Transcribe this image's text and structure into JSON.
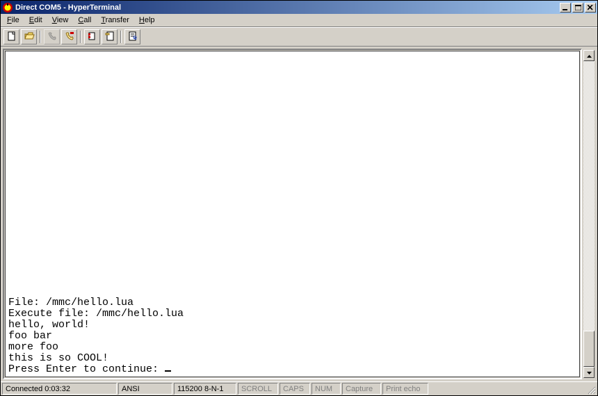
{
  "title": "Direct COM5 - HyperTerminal",
  "menus": {
    "file": "File",
    "edit": "Edit",
    "view": "View",
    "call": "Call",
    "transfer": "Transfer",
    "help": "Help"
  },
  "terminal": {
    "lines": [
      "File: /mmc/hello.lua",
      "Execute file: /mmc/hello.lua",
      "hello, world!",
      "foo bar",
      "more foo",
      "this is so COOL!",
      "Press Enter to continue: "
    ]
  },
  "status": {
    "connected": "Connected 0:03:32",
    "emulation": "ANSI",
    "settings": "115200 8-N-1",
    "scroll": "SCROLL",
    "caps": "CAPS",
    "num": "NUM",
    "capture": "Capture",
    "printecho": "Print echo"
  }
}
